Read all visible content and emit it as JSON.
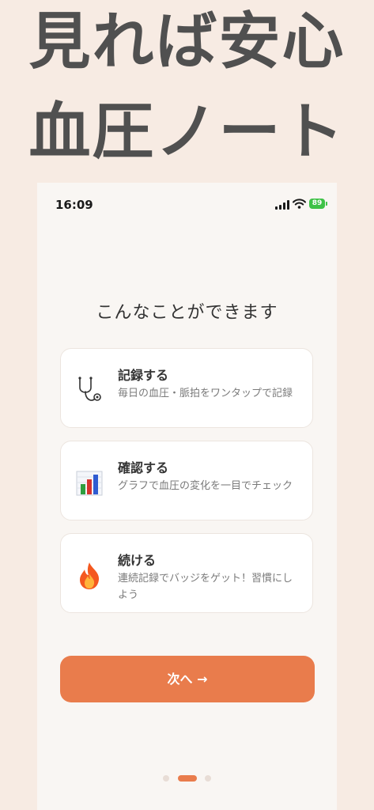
{
  "promo": {
    "line1": "見れば安心",
    "line2": "血圧ノート"
  },
  "status_bar": {
    "time": "16:09",
    "battery": "89"
  },
  "onboarding": {
    "heading": "こんなことができます",
    "features": [
      {
        "icon": "stethoscope-icon",
        "title": "記録する",
        "description": "毎日の血圧・脈拍をワンタップで記録"
      },
      {
        "icon": "bar-chart-icon",
        "title": "確認する",
        "description": "グラフで血圧の変化を一目でチェック"
      },
      {
        "icon": "fire-icon",
        "title": "続ける",
        "description": "連続記録でバッジをゲット！習慣にしよう"
      }
    ],
    "next_button": "次へ →",
    "page_indicator": {
      "total": 3,
      "current": 2
    }
  },
  "colors": {
    "background": "#f7ebe3",
    "screen": "#f9f6f3",
    "accent": "#e97c4c",
    "headline": "#505050",
    "battery": "#3fc247"
  }
}
